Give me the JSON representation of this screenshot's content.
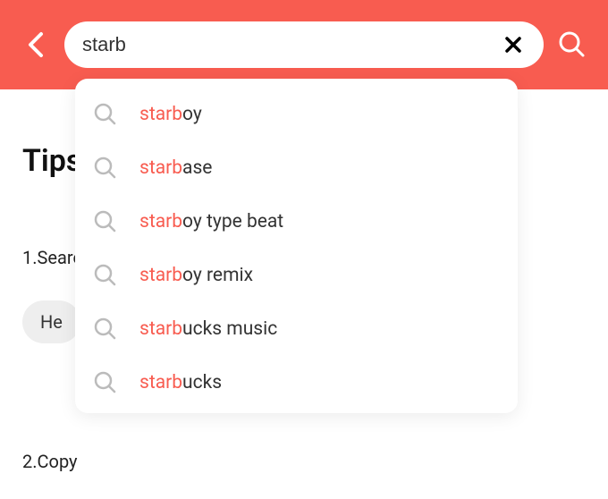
{
  "header": {
    "accent_color": "#f85c50"
  },
  "search": {
    "query": "starb",
    "placeholder": ""
  },
  "suggestions": [
    {
      "prefix": "starb",
      "suffix": "oy"
    },
    {
      "prefix": "starb",
      "suffix": "ase"
    },
    {
      "prefix": "starb",
      "suffix": "oy type beat"
    },
    {
      "prefix": "starb",
      "suffix": "oy remix"
    },
    {
      "prefix": "starb",
      "suffix": "ucks music"
    },
    {
      "prefix": "starb",
      "suffix": "ucks"
    }
  ],
  "background": {
    "tips_title": "Tips",
    "tip1": "1.Searc",
    "pill1": "He",
    "tip2": "2.Copy"
  }
}
